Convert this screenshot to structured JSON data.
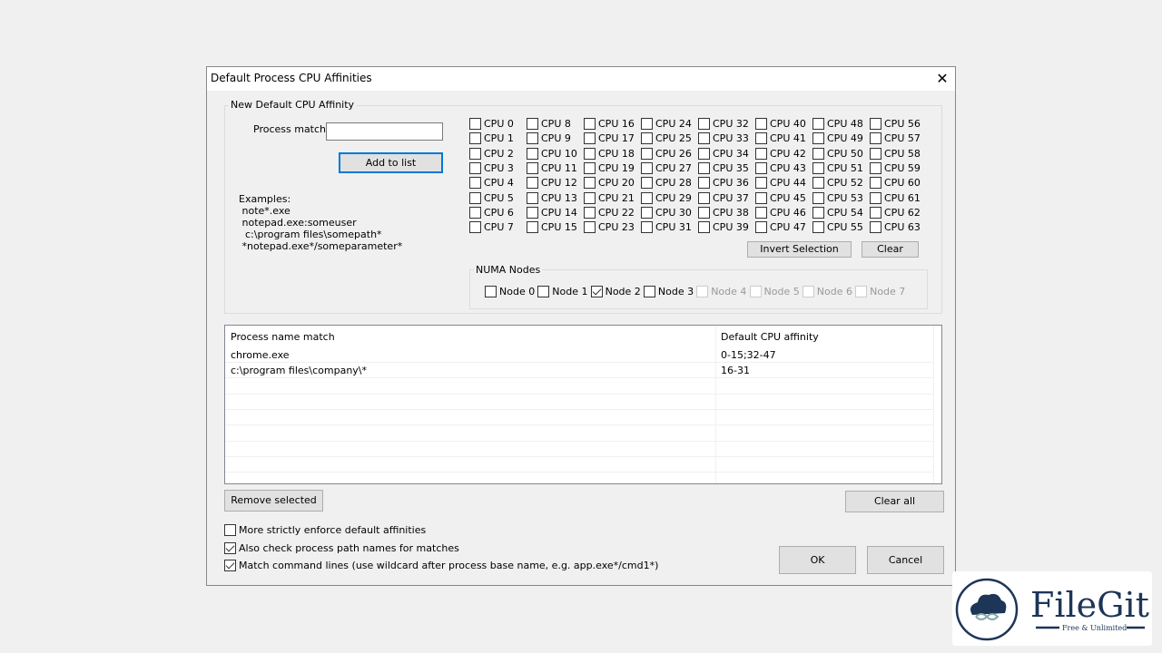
{
  "dialog": {
    "title": "Default Process CPU Affinities",
    "close_icon": "close-icon"
  },
  "affinity_group": {
    "label": "New Default CPU Affinity",
    "process_match_label": "Process match:",
    "process_match_value": "",
    "add_button": "Add to list",
    "examples": [
      "Examples:",
      " note*.exe",
      " notepad.exe:someuser",
      "  c:\\program files\\somepath*",
      " *notepad.exe*/someparameter*"
    ]
  },
  "cpus": {
    "count": 64,
    "prefix": "CPU ",
    "checked": []
  },
  "cpu_buttons": {
    "invert": "Invert Selection",
    "clear": "Clear"
  },
  "numa": {
    "label": "NUMA Nodes",
    "nodes": [
      {
        "label": "Node 0",
        "checked": false,
        "enabled": true
      },
      {
        "label": "Node 1",
        "checked": false,
        "enabled": true
      },
      {
        "label": "Node 2",
        "checked": true,
        "enabled": true
      },
      {
        "label": "Node 3",
        "checked": false,
        "enabled": true
      },
      {
        "label": "Node 4",
        "checked": false,
        "enabled": false
      },
      {
        "label": "Node 5",
        "checked": false,
        "enabled": false
      },
      {
        "label": "Node 6",
        "checked": false,
        "enabled": false
      },
      {
        "label": "Node 7",
        "checked": false,
        "enabled": false
      }
    ]
  },
  "list": {
    "columns": [
      "Process name match",
      "Default CPU affinity"
    ],
    "rows": [
      [
        "chrome.exe",
        "0-15;32-47"
      ],
      [
        "c:\\program files\\company\\*",
        "16-31"
      ]
    ]
  },
  "buttons": {
    "remove_selected": "Remove selected",
    "clear_all": "Clear all",
    "ok": "OK",
    "cancel": "Cancel"
  },
  "options": [
    {
      "label": "More strictly enforce default affinities",
      "checked": false
    },
    {
      "label": "Also check process path names for matches",
      "checked": true
    },
    {
      "label": "Match command lines (use wildcard after process base name, e.g. app.exe*/cmd1*)",
      "checked": true
    }
  ],
  "watermark": {
    "name": "FileGit",
    "tagline": "Free & Unlimited"
  }
}
